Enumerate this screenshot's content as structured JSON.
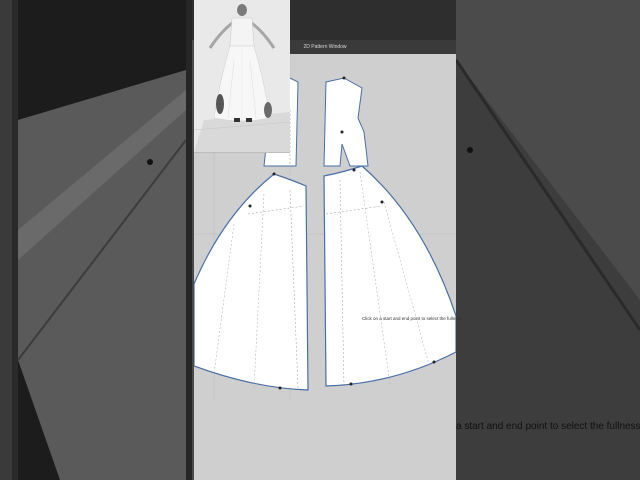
{
  "pattern_window": {
    "title": "2D Pattern Window"
  },
  "status": {
    "hint": "Click on a start and end point to select the fullness",
    "hint_zoomed": "a start and end point to select the fullness"
  },
  "colors": {
    "pattern_fill": "#ffffff",
    "pattern_outline": "#4a6fa5",
    "background": "#cfcfcf"
  }
}
